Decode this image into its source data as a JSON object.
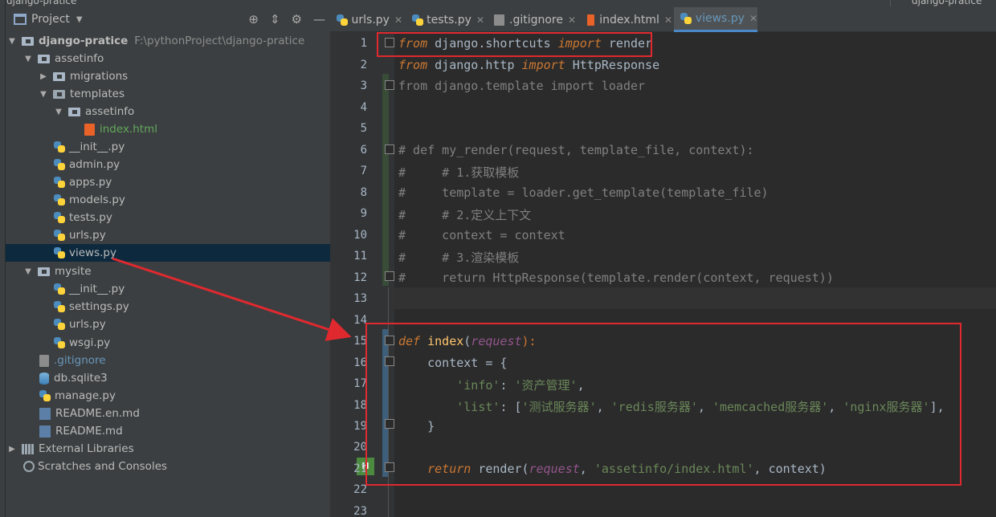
{
  "sidebar": {
    "title": "Project",
    "tree": [
      {
        "label": "django-pratice",
        "path": "F:\\pythonProject\\django-pratice",
        "icon": "folder-icon"
      },
      {
        "label": "assetinfo",
        "icon": "folder-icon"
      },
      {
        "label": "migrations",
        "icon": "folder-icon"
      },
      {
        "label": "templates",
        "icon": "folder-icon"
      },
      {
        "label": "assetinfo",
        "icon": "folder-icon"
      },
      {
        "label": "index.html",
        "icon": "html-file-icon"
      },
      {
        "label": "__init__.py",
        "icon": "python-file-icon"
      },
      {
        "label": "admin.py",
        "icon": "python-file-icon"
      },
      {
        "label": "apps.py",
        "icon": "python-file-icon"
      },
      {
        "label": "models.py",
        "icon": "python-file-icon"
      },
      {
        "label": "tests.py",
        "icon": "python-file-icon"
      },
      {
        "label": "urls.py",
        "icon": "python-file-icon"
      },
      {
        "label": "views.py",
        "icon": "python-file-icon",
        "selected": true
      },
      {
        "label": "mysite",
        "icon": "folder-icon"
      },
      {
        "label": "__init__.py",
        "icon": "python-file-icon"
      },
      {
        "label": "settings.py",
        "icon": "python-file-icon"
      },
      {
        "label": "urls.py",
        "icon": "python-file-icon"
      },
      {
        "label": "wsgi.py",
        "icon": "python-file-icon"
      },
      {
        "label": ".gitignore",
        "icon": "gitignore-file-icon"
      },
      {
        "label": "db.sqlite3",
        "icon": "database-icon"
      },
      {
        "label": "manage.py",
        "icon": "python-file-icon"
      },
      {
        "label": "README.en.md",
        "icon": "markdown-file-icon"
      },
      {
        "label": "README.md",
        "icon": "markdown-file-icon"
      },
      {
        "label": "External Libraries",
        "icon": "library-icon"
      },
      {
        "label": "Scratches and Consoles",
        "icon": "scratches-icon"
      }
    ]
  },
  "tabs": [
    {
      "label": "urls.py"
    },
    {
      "label": "tests.py"
    },
    {
      "label": ".gitignore"
    },
    {
      "label": "index.html"
    },
    {
      "label": "views.py",
      "active": true
    }
  ],
  "editor": {
    "line_numbers": [
      "1",
      "2",
      "3",
      "4",
      "5",
      "6",
      "7",
      "8",
      "9",
      "10",
      "11",
      "12",
      "13",
      "14",
      "15",
      "16",
      "17",
      "18",
      "19",
      "20",
      "21",
      "22",
      "23"
    ],
    "code": {
      "l1": {
        "a": "from",
        "b": " django.shortcuts ",
        "c": "import",
        "d": " render"
      },
      "l2": {
        "a": "from",
        "b": " django.http ",
        "c": "import",
        "d": " HttpResponse"
      },
      "l3": "from django.template import loader",
      "l6": "# def my_render(request, template_file, context):",
      "l7": "#     # 1.获取模板",
      "l8": "#     template = loader.get_template(template_file)",
      "l9": "#     # 2.定义上下文",
      "l10": "#     context = context",
      "l11": "#     # 3.渲染模板",
      "l12": "#     return HttpResponse(template.render(context, request))",
      "l15": {
        "a": "def",
        "b": "index",
        "c": "(",
        "d": "request",
        "e": "):"
      },
      "l16": {
        "a": "    context = {"
      },
      "l17": {
        "a": "        ",
        "b": "'info'",
        "c": ": ",
        "d": "'资产管理'",
        "e": ","
      },
      "l18": {
        "a": "        ",
        "b": "'list'",
        "c": ": [",
        "d": "'测试服务器'",
        "e": ", ",
        "f": "'redis服务器'",
        "g": ", ",
        "h": "'memcached服务器'",
        "i": ", ",
        "j": "'nginx服务器'",
        "k": "],"
      },
      "l19": {
        "a": "    }"
      },
      "l21": {
        "a": "    ",
        "b": "return",
        "c": " render(",
        "d": "request",
        "e": ", ",
        "f": "'assetinfo/index.html'",
        "g": ", context)"
      }
    }
  },
  "top_cut": {
    "left": "django-pratice",
    "right": "django-pratice"
  },
  "colors": {
    "annotation_red": "#e0292f",
    "keyword": "#cc7832",
    "string": "#6a8759",
    "comment": "#808080",
    "selection": "#0d293e"
  }
}
